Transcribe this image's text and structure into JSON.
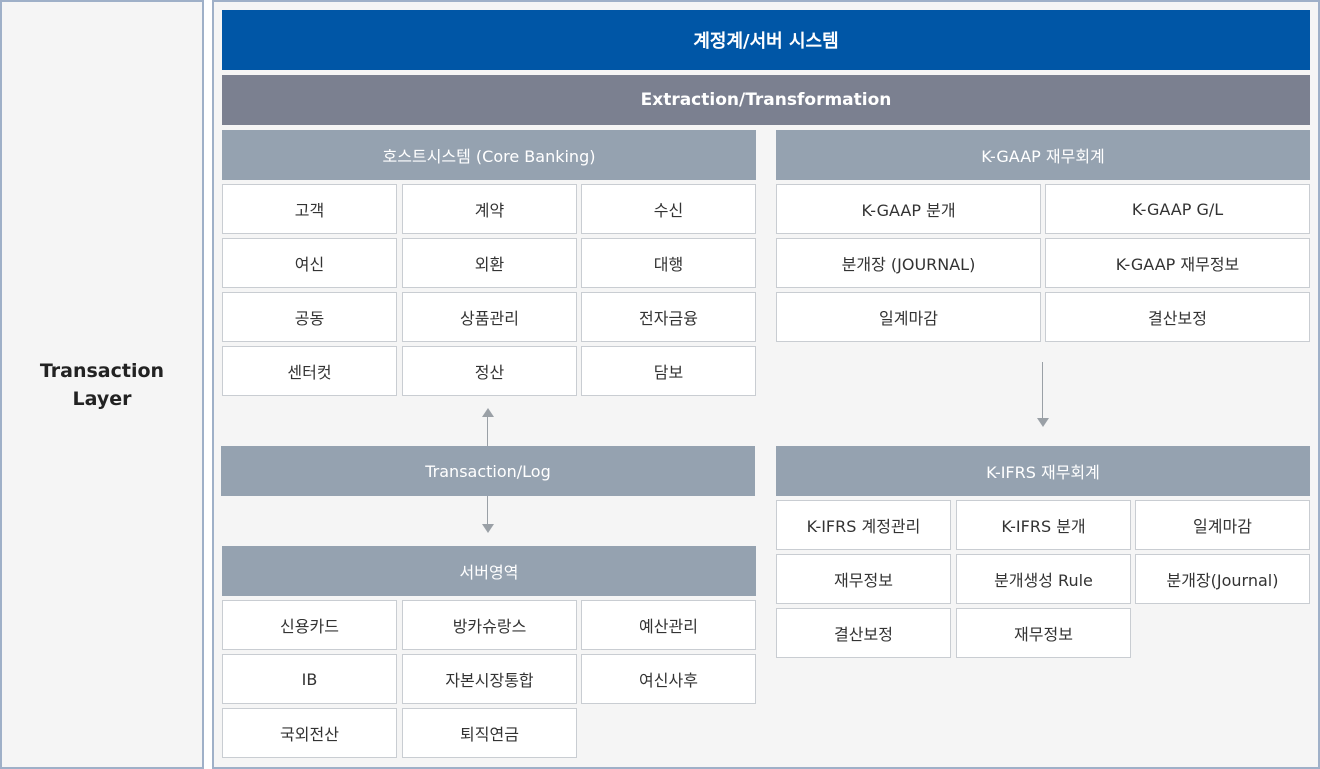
{
  "layer_label": "Transaction\nLayer",
  "top_bar": "계정계/서버 시스템",
  "second_bar": "Extraction/Transformation",
  "host": {
    "title": "호스트시스템 (Core Banking)",
    "cells": [
      "고객",
      "계약",
      "수신",
      "여신",
      "외환",
      "대행",
      "공동",
      "상품관리",
      "전자금융",
      "센터컷",
      "정산",
      "담보"
    ]
  },
  "transaction_log": "Transaction/Log",
  "server": {
    "title": "서버영역",
    "cells": [
      "신용카드",
      "방카슈랑스",
      "예산관리",
      "IB",
      "자본시장통합",
      "여신사후",
      "국외전산",
      "퇴직연금"
    ]
  },
  "kgaap": {
    "title": "K-GAAP 재무회계",
    "cells": [
      "K-GAAP 분개",
      "K-GAAP G/L",
      "분개장 (JOURNAL)",
      "K-GAAP 재무정보",
      "일계마감",
      "결산보정"
    ]
  },
  "kifrs": {
    "title": "K-IFRS 재무회계",
    "cells": [
      "K-IFRS 계정관리",
      "K-IFRS 분개",
      "일계마감",
      "재무정보",
      "분개생성 Rule",
      "분개장(Journal)",
      "결산보정",
      "재무정보"
    ]
  }
}
